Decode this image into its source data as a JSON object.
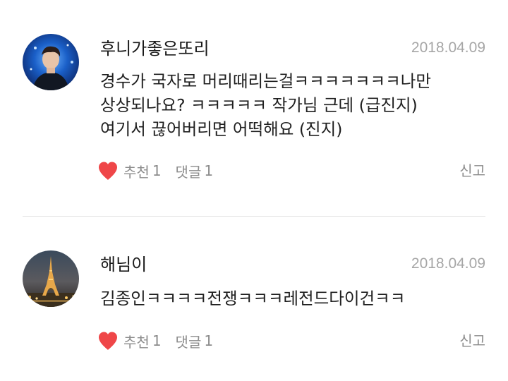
{
  "comments": [
    {
      "username": "후니가좋은또리",
      "date": "2018.04.09",
      "avatar": "profile-photo-performer",
      "lines": [
        "경수가 국자로 머리때리는걸ㅋㅋㅋㅋㅋㅋㅋ나만",
        "상상되나요? ㅋㅋㅋㅋㅋ 작가님 근데 (급진지)",
        "여기서 끊어버리면 어떡해요 (진지)"
      ],
      "like_label": "추천",
      "like_count": "1",
      "reply_label": "댓글",
      "reply_count": "1",
      "report_label": "신고"
    },
    {
      "username": "해님이",
      "date": "2018.04.09",
      "avatar": "profile-photo-eiffel-tower",
      "lines": [
        "김종인ㅋㅋㅋㅋ전쟁ㅋㅋㅋ레전드다이건ㅋㅋ"
      ],
      "like_label": "추천",
      "like_count": "1",
      "reply_label": "댓글",
      "reply_count": "1",
      "report_label": "신고"
    }
  ],
  "colors": {
    "heart": "#ef4648",
    "meta_text": "#8c8c8c",
    "date_text": "#a6a6a6",
    "divider": "#e3e3e3"
  },
  "icons": {
    "like": "heart-icon"
  }
}
